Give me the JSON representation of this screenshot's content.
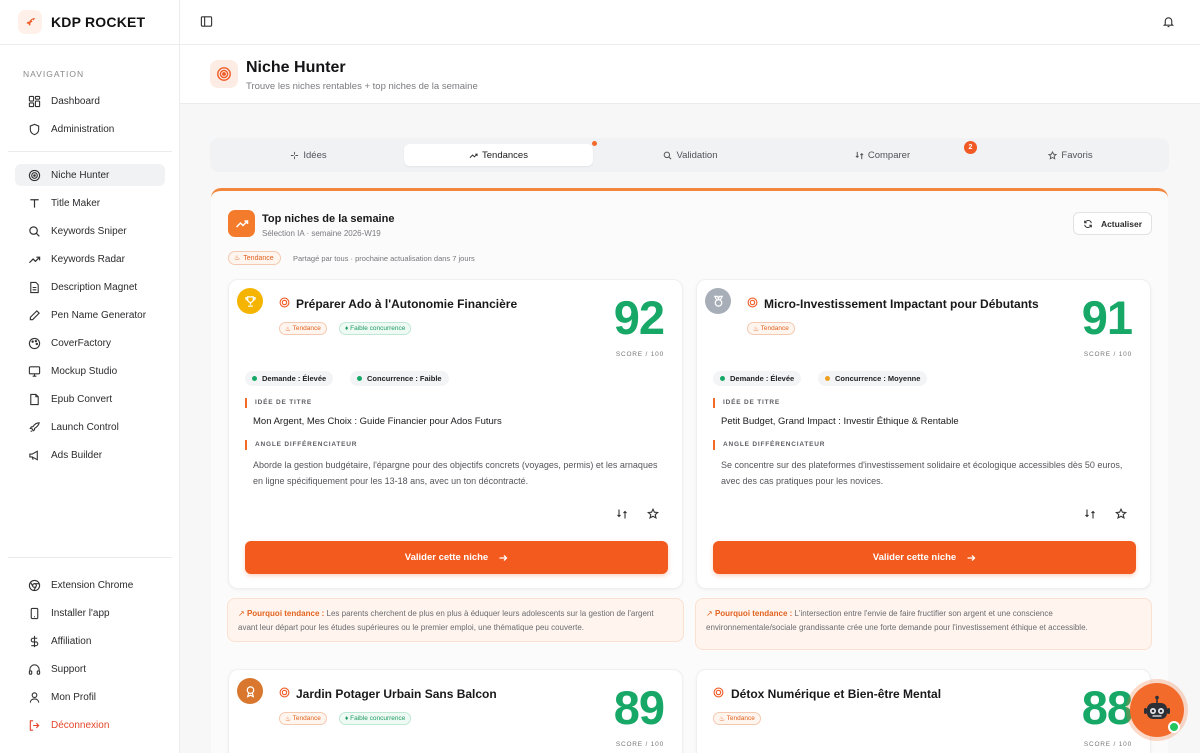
{
  "app": {
    "name": "KDP ROCKET"
  },
  "sidebar": {
    "heading": "NAVIGATION",
    "items": [
      {
        "label": "Dashboard"
      },
      {
        "label": "Administration"
      },
      {
        "label": "Niche Hunter"
      },
      {
        "label": "Title Maker"
      },
      {
        "label": "Keywords Sniper"
      },
      {
        "label": "Keywords Radar"
      },
      {
        "label": "Description Magnet"
      },
      {
        "label": "Pen Name Generator"
      },
      {
        "label": "CoverFactory"
      },
      {
        "label": "Mockup Studio"
      },
      {
        "label": "Epub Convert"
      },
      {
        "label": "Launch Control"
      },
      {
        "label": "Ads Builder"
      }
    ],
    "bottom_items": [
      {
        "label": "Extension Chrome"
      },
      {
        "label": "Installer l'app"
      },
      {
        "label": "Affiliation"
      },
      {
        "label": "Support"
      },
      {
        "label": "Mon Profil"
      },
      {
        "label": "Déconnexion"
      }
    ]
  },
  "page": {
    "title": "Niche Hunter",
    "subtitle": "Trouve les niches rentables + top niches de la semaine"
  },
  "tabs": [
    {
      "label": "Idées"
    },
    {
      "label": "Tendances",
      "active": true
    },
    {
      "label": "Validation"
    },
    {
      "label": "Comparer",
      "badge": "2"
    },
    {
      "label": "Favoris"
    }
  ],
  "section": {
    "title": "Top niches de la semaine",
    "subtitle": "Sélection IA · semaine 2026-W19",
    "refresh_label": "Actualiser",
    "trend_tag": "Tendance",
    "shared_note": "Partagé par tous · prochaine actualisation dans 7 jours",
    "score_caption": "SCORE / 100",
    "title_label": "IDÉE DE TITRE",
    "angle_label": "ANGLE DIFFÉRENCIATEUR",
    "cta_label": "Valider cette niche",
    "why_label": "Pourquoi tendance :"
  },
  "cards": [
    {
      "title": "Préparer Ado à l'Autonomie Financière",
      "tags": [
        "Tendance",
        "Faible concurrence"
      ],
      "score": "92",
      "demand": "Demande : Élevée",
      "competition": "Concurrence : Faible",
      "title_idea": "Mon Argent, Mes Choix : Guide Financier pour Ados Futurs",
      "angle": "Aborde la gestion budgétaire, l'épargne pour des objectifs concrets (voyages, permis) et les arnaques en ligne spécifiquement pour les 13-18 ans, avec un ton décontracté.",
      "why": "Les parents cherchent de plus en plus à éduquer leurs adolescents sur la gestion de l'argent avant leur départ pour les études supérieures ou le premier emploi, une thématique peu couverte."
    },
    {
      "title": "Micro-Investissement Impactant pour Débutants",
      "tags": [
        "Tendance"
      ],
      "score": "91",
      "demand": "Demande : Élevée",
      "competition": "Concurrence : Moyenne",
      "title_idea": "Petit Budget, Grand Impact : Investir Éthique & Rentable",
      "angle": "Se concentre sur des plateformes d'investissement solidaire et écologique accessibles dès 50 euros, avec des cas pratiques pour les novices.",
      "why": "L'intersection entre l'envie de faire fructifier son argent et une conscience environnementale/sociale grandissante crée une forte demande pour l'investissement éthique et accessible."
    },
    {
      "title": "Jardin Potager Urbain Sans Balcon",
      "tags": [
        "Tendance",
        "Faible concurrence"
      ],
      "score": "89"
    },
    {
      "title": "Détox Numérique et Bien-être Mental",
      "tags": [
        "Tendance"
      ],
      "score": "88"
    }
  ],
  "colors": {
    "accent": "#f35a1e",
    "score": "#17a868",
    "demand_dot": "#17a868",
    "competition_low_dot": "#17a868",
    "competition_mid_dot": "#f0a020"
  }
}
